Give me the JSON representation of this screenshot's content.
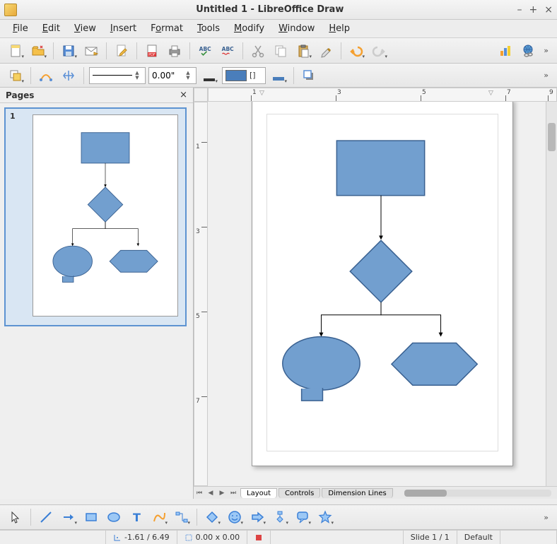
{
  "window": {
    "title": "Untitled 1 - LibreOffice Draw"
  },
  "menu": {
    "file": "File",
    "edit": "Edit",
    "view": "View",
    "insert": "Insert",
    "format": "Format",
    "tools": "Tools",
    "modify": "Modify",
    "window": "Window",
    "help": "Help"
  },
  "toolbar2": {
    "line_width": "0.00\"",
    "area_style_label": "[]"
  },
  "colors": {
    "fill": "#729fcf",
    "fill_swatch": "#4a7ebb",
    "stroke": "#3a6191"
  },
  "pages_panel": {
    "title": "Pages",
    "page_number": "1"
  },
  "hruler": {
    "labels": [
      "1",
      "1",
      "3",
      "5",
      "7",
      "9"
    ]
  },
  "vruler": {
    "labels": [
      "1",
      "1",
      "3",
      "5",
      "7"
    ]
  },
  "tabs": {
    "layout": "Layout",
    "controls": "Controls",
    "dimension": "Dimension Lines"
  },
  "status": {
    "coords": "-1.61 / 6.49",
    "size": "0.00 x 0.00",
    "slide": "Slide 1 / 1",
    "style": "Default"
  }
}
